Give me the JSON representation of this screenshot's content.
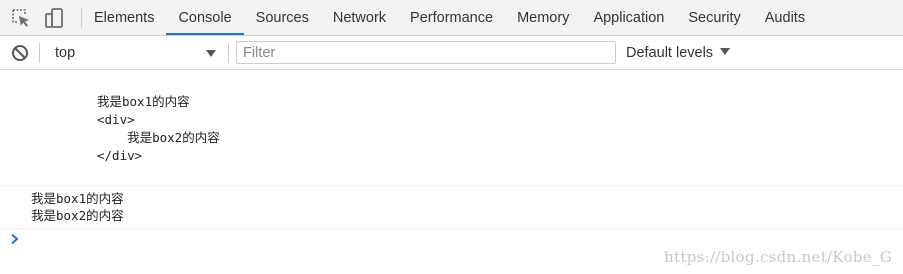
{
  "toolbar": {
    "inspect_icon": "inspect-element-icon",
    "device_icon": "device-toolbar-icon"
  },
  "tabs": [
    {
      "label": "Elements",
      "active": false
    },
    {
      "label": "Console",
      "active": true
    },
    {
      "label": "Sources",
      "active": false
    },
    {
      "label": "Network",
      "active": false
    },
    {
      "label": "Performance",
      "active": false
    },
    {
      "label": "Memory",
      "active": false
    },
    {
      "label": "Application",
      "active": false
    },
    {
      "label": "Security",
      "active": false
    },
    {
      "label": "Audits",
      "active": false
    }
  ],
  "console_toolbar": {
    "clear_icon": "clear-console-icon",
    "context": "top",
    "filter_value": "",
    "filter_placeholder": "Filter",
    "levels_label": "Default levels"
  },
  "messages": [
    {
      "lines": [
        "我是box1的内容",
        "<div>",
        "    我是box2的内容",
        "</div>"
      ]
    },
    {
      "lines": [
        "我是box1的内容",
        "我是box2的内容"
      ]
    }
  ],
  "prompt_icon": "chevron-right-icon",
  "watermark": "https://blog.csdn.net/Kobe_G",
  "colors": {
    "active_tab_underline": "#1a73e8",
    "prompt": "#1a73e8",
    "tabbar_bg": "#f3f3f3"
  }
}
